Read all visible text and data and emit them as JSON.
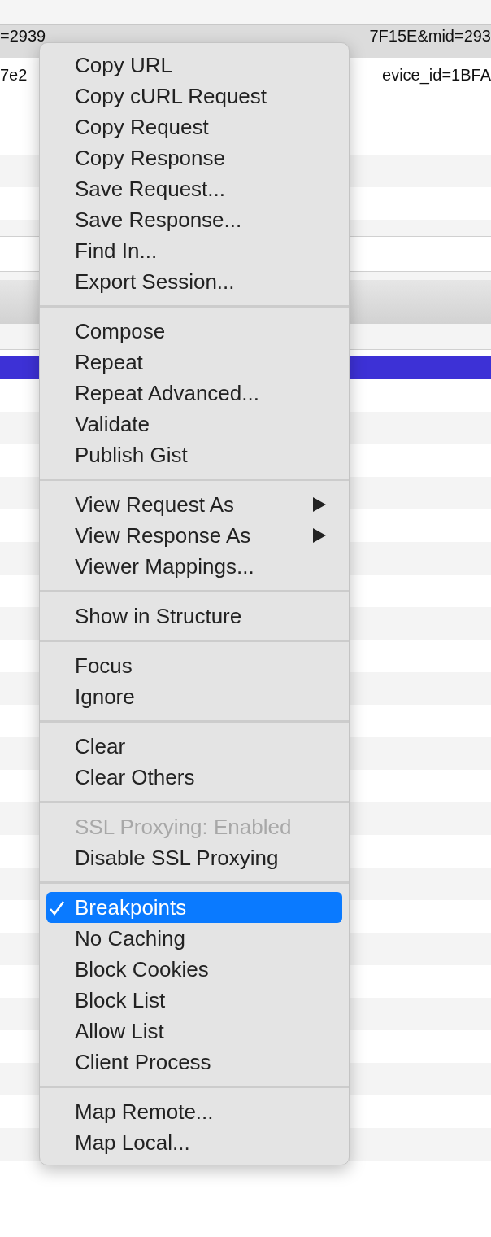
{
  "background_rows": [
    {
      "left": "=2939",
      "right": "7F15E&mid=293"
    },
    {
      "left": "7e2",
      "right": "evice_id=1BFA"
    }
  ],
  "context_menu": {
    "groups": [
      {
        "items": [
          {
            "label": "Copy URL",
            "kind": "item",
            "disabled": false,
            "checked": false,
            "selected": false
          },
          {
            "label": "Copy cURL Request",
            "kind": "item",
            "disabled": false,
            "checked": false,
            "selected": false
          },
          {
            "label": "Copy Request",
            "kind": "item",
            "disabled": false,
            "checked": false,
            "selected": false
          },
          {
            "label": "Copy Response",
            "kind": "item",
            "disabled": false,
            "checked": false,
            "selected": false
          },
          {
            "label": "Save Request...",
            "kind": "item",
            "disabled": false,
            "checked": false,
            "selected": false
          },
          {
            "label": "Save Response...",
            "kind": "item",
            "disabled": false,
            "checked": false,
            "selected": false
          },
          {
            "label": "Find In...",
            "kind": "item",
            "disabled": false,
            "checked": false,
            "selected": false
          },
          {
            "label": "Export Session...",
            "kind": "item",
            "disabled": false,
            "checked": false,
            "selected": false
          }
        ]
      },
      {
        "items": [
          {
            "label": "Compose",
            "kind": "item",
            "disabled": false,
            "checked": false,
            "selected": false
          },
          {
            "label": "Repeat",
            "kind": "item",
            "disabled": false,
            "checked": false,
            "selected": false
          },
          {
            "label": "Repeat Advanced...",
            "kind": "item",
            "disabled": false,
            "checked": false,
            "selected": false
          },
          {
            "label": "Validate",
            "kind": "item",
            "disabled": false,
            "checked": false,
            "selected": false
          },
          {
            "label": "Publish Gist",
            "kind": "item",
            "disabled": false,
            "checked": false,
            "selected": false
          }
        ]
      },
      {
        "items": [
          {
            "label": "View Request As",
            "kind": "submenu",
            "disabled": false,
            "checked": false,
            "selected": false
          },
          {
            "label": "View Response As",
            "kind": "submenu",
            "disabled": false,
            "checked": false,
            "selected": false
          },
          {
            "label": "Viewer Mappings...",
            "kind": "item",
            "disabled": false,
            "checked": false,
            "selected": false
          }
        ]
      },
      {
        "items": [
          {
            "label": "Show in Structure",
            "kind": "item",
            "disabled": false,
            "checked": false,
            "selected": false
          }
        ]
      },
      {
        "items": [
          {
            "label": "Focus",
            "kind": "item",
            "disabled": false,
            "checked": false,
            "selected": false
          },
          {
            "label": "Ignore",
            "kind": "item",
            "disabled": false,
            "checked": false,
            "selected": false
          }
        ]
      },
      {
        "items": [
          {
            "label": "Clear",
            "kind": "item",
            "disabled": false,
            "checked": false,
            "selected": false
          },
          {
            "label": "Clear Others",
            "kind": "item",
            "disabled": false,
            "checked": false,
            "selected": false
          }
        ]
      },
      {
        "items": [
          {
            "label": "SSL Proxying: Enabled",
            "kind": "item",
            "disabled": true,
            "checked": false,
            "selected": false
          },
          {
            "label": "Disable SSL Proxying",
            "kind": "item",
            "disabled": false,
            "checked": false,
            "selected": false
          }
        ]
      },
      {
        "items": [
          {
            "label": "Breakpoints",
            "kind": "item",
            "disabled": false,
            "checked": true,
            "selected": true
          },
          {
            "label": "No Caching",
            "kind": "item",
            "disabled": false,
            "checked": false,
            "selected": false
          },
          {
            "label": "Block Cookies",
            "kind": "item",
            "disabled": false,
            "checked": false,
            "selected": false
          },
          {
            "label": "Block List",
            "kind": "item",
            "disabled": false,
            "checked": false,
            "selected": false
          },
          {
            "label": "Allow List",
            "kind": "item",
            "disabled": false,
            "checked": false,
            "selected": false
          },
          {
            "label": "Client Process",
            "kind": "item",
            "disabled": false,
            "checked": false,
            "selected": false
          }
        ]
      },
      {
        "items": [
          {
            "label": "Map Remote...",
            "kind": "item",
            "disabled": false,
            "checked": false,
            "selected": false
          },
          {
            "label": "Map Local...",
            "kind": "item",
            "disabled": false,
            "checked": false,
            "selected": false
          }
        ]
      }
    ]
  }
}
